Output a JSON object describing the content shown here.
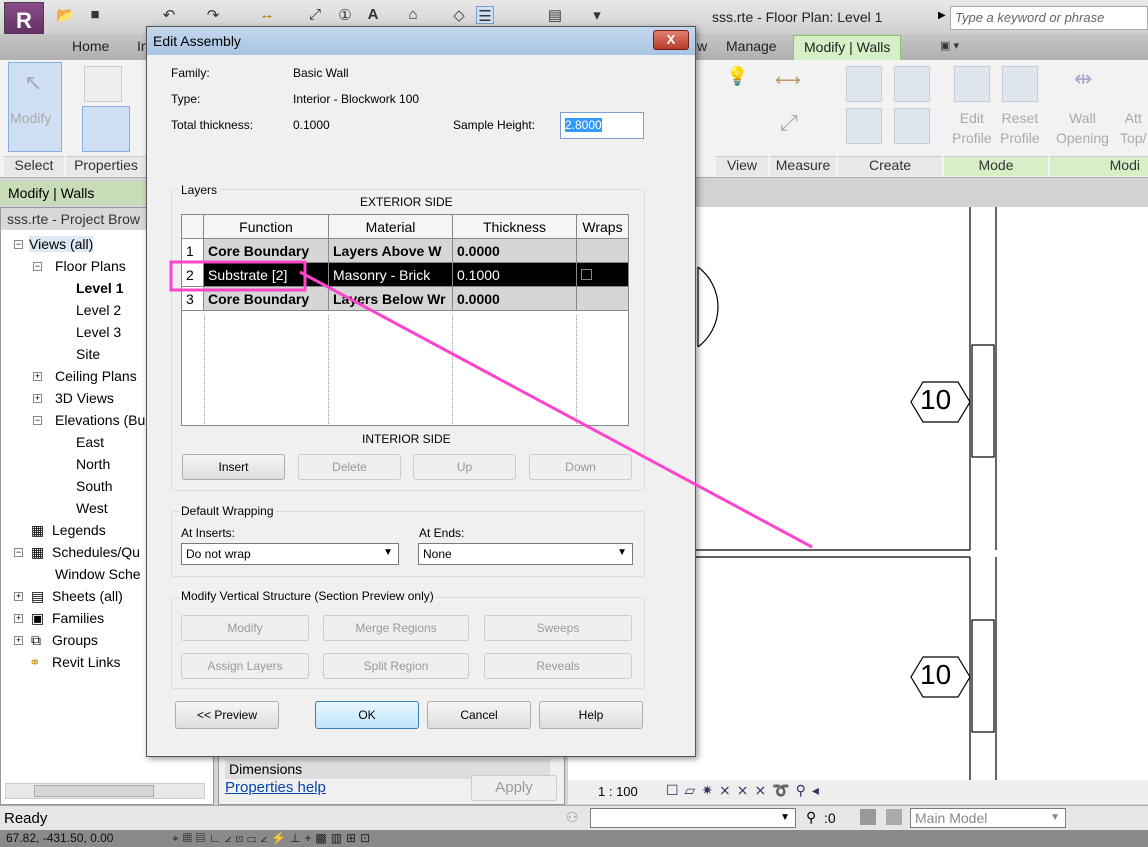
{
  "app": {
    "title": "sss.rte - Floor Plan: Level 1",
    "search_placeholder": "Type a keyword or phrase",
    "app_letter": "R"
  },
  "tabs": [
    "Home",
    "In",
    "w",
    "Manage",
    "Modify | Walls"
  ],
  "ribbon": {
    "panels": [
      "Select",
      "Properties",
      "View",
      "Measure",
      "Create",
      "Mode",
      "Modi"
    ],
    "buttons": {
      "modify": "Modify",
      "edit_profile": [
        "Edit",
        "Profile"
      ],
      "reset_profile": [
        "Reset",
        "Profile"
      ],
      "wall_opening": [
        "Wall",
        "Opening"
      ],
      "attach": [
        "Att",
        "Top/"
      ]
    }
  },
  "context_label": "Modify | Walls",
  "browser": {
    "title": "sss.rte - Project Brow",
    "items": [
      "Views (all)",
      "Floor Plans",
      "Level 1",
      "Level 2",
      "Level 3",
      "Site",
      "Ceiling Plans",
      "3D Views",
      "Elevations (Bu",
      "East",
      "North",
      "South",
      "West",
      "Legends",
      "Schedules/Qu",
      "Window Sche",
      "Sheets (all)",
      "Families",
      "Groups",
      "Revit Links"
    ]
  },
  "properties": {
    "section": "Dimensions",
    "help_link": "Properties help",
    "apply": "Apply"
  },
  "dialog": {
    "title": "Edit Assembly",
    "close": "X",
    "family_label": "Family:",
    "family": "Basic Wall",
    "type_label": "Type:",
    "type": "Interior - Blockwork 100",
    "thickness_label": "Total thickness:",
    "thickness": "0.1000",
    "sample_height_label": "Sample Height:",
    "sample_height": "2.8000",
    "layers_label": "Layers",
    "exterior": "EXTERIOR SIDE",
    "interior": "INTERIOR SIDE",
    "columns": [
      "Function",
      "Material",
      "Thickness",
      "Wraps"
    ],
    "rows": [
      {
        "num": "1",
        "function": "Core Boundary",
        "material": "Layers Above W",
        "thickness": "0.0000"
      },
      {
        "num": "2",
        "function": "Substrate [2]",
        "material": "Masonry - Brick",
        "thickness": "0.1000"
      },
      {
        "num": "3",
        "function": "Core Boundary",
        "material": "Layers Below Wr",
        "thickness": "0.0000"
      }
    ],
    "layer_buttons": [
      "Insert",
      "Delete",
      "Up",
      "Down"
    ],
    "default_wrapping": "Default Wrapping",
    "at_inserts_label": "At Inserts:",
    "at_inserts": "Do not wrap",
    "at_ends_label": "At  Ends:",
    "at_ends": "None",
    "vertical_label": "Modify Vertical Structure (Section Preview only)",
    "vertical_buttons": [
      "Modify",
      "Merge Regions",
      "Sweeps",
      "Assign Layers",
      "Split Region",
      "Reveals"
    ],
    "footer_buttons": [
      "<< Preview",
      "OK",
      "Cancel",
      "Help"
    ]
  },
  "canvas": {
    "tags": [
      "10",
      "10"
    ]
  },
  "view_control": {
    "scale": "1 : 100"
  },
  "status": {
    "text": "Ready",
    "worksets": ":0",
    "model": "Main Model",
    "coords": "67.82, -431.50, 0.00"
  },
  "colors": {
    "annotation": "#ff44cc",
    "selected_row": "#000000",
    "active_tab": "#d7efc7"
  }
}
